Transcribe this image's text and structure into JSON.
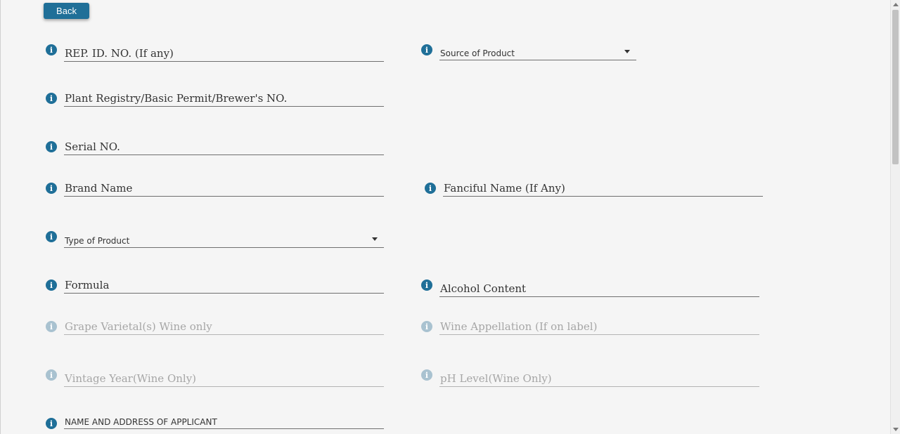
{
  "header": {
    "back_label": "Back"
  },
  "form": {
    "rep_id": "REP. ID. NO. (If any)",
    "source_of_product": "Source of Product",
    "plant_registry": "Plant Registry/Basic Permit/Brewer's NO.",
    "serial_no": "Serial NO.",
    "brand_name": "Brand Name",
    "fanciful_name": "Fanciful Name (If Any)",
    "type_of_product": "Type of Product",
    "formula": "Formula",
    "alcohol_content": "Alcohol Content",
    "grape_varietal": "Grape Varietal(s) Wine only",
    "wine_appellation": "Wine Appellation (If on label)",
    "vintage_year": "Vintage Year(Wine Only)",
    "ph_level": "pH Level(Wine Only)",
    "name_address": "NAME AND ADDRESS OF APPLICANT"
  },
  "icons": {
    "info": "info-icon",
    "dropdown": "chevron-down-icon"
  },
  "colors": {
    "accent": "#1f6f98",
    "accent_disabled": "#a9c2d0",
    "background": "#f5f5f5",
    "disabled_text": "#a6a6a6"
  }
}
